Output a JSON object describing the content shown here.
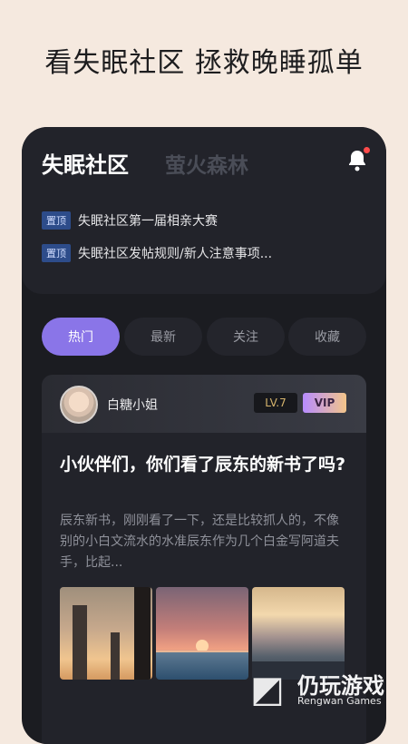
{
  "headline": "看失眠社区  拯救晚睡孤单",
  "header": {
    "tabs": [
      "失眠社区",
      "萤火森林"
    ],
    "notification_icon": "bell-icon",
    "notification_dot_color": "#ff4b4b"
  },
  "pinned": [
    {
      "badge": "置顶",
      "text": "失眠社区第一届相亲大赛"
    },
    {
      "badge": "置顶",
      "text": "失眠社区发帖规则/新人注意事项..."
    }
  ],
  "filters": [
    {
      "label": "热门",
      "active": true
    },
    {
      "label": "最新",
      "active": false
    },
    {
      "label": "关注",
      "active": false
    },
    {
      "label": "收藏",
      "active": false
    }
  ],
  "post": {
    "author": "白糖小姐",
    "level": "LV.7",
    "vip": "VIP",
    "title": "小伙伴们，你们看了辰东的新书了吗?",
    "excerpt": "辰东新书，刚刚看了一下，还是比较抓人的，不像别的小白文流水的水准辰东作为几个白金写阿道夫手，比起...",
    "images": [
      "city-sunset",
      "sea-sunset",
      "harbor-city"
    ]
  },
  "watermark": {
    "name": "仍玩游戏",
    "subtitle": "Rengwan Games"
  },
  "colors": {
    "accent": "#8a75e8",
    "background": "#f5e9df",
    "panel": "#1b1c21"
  }
}
